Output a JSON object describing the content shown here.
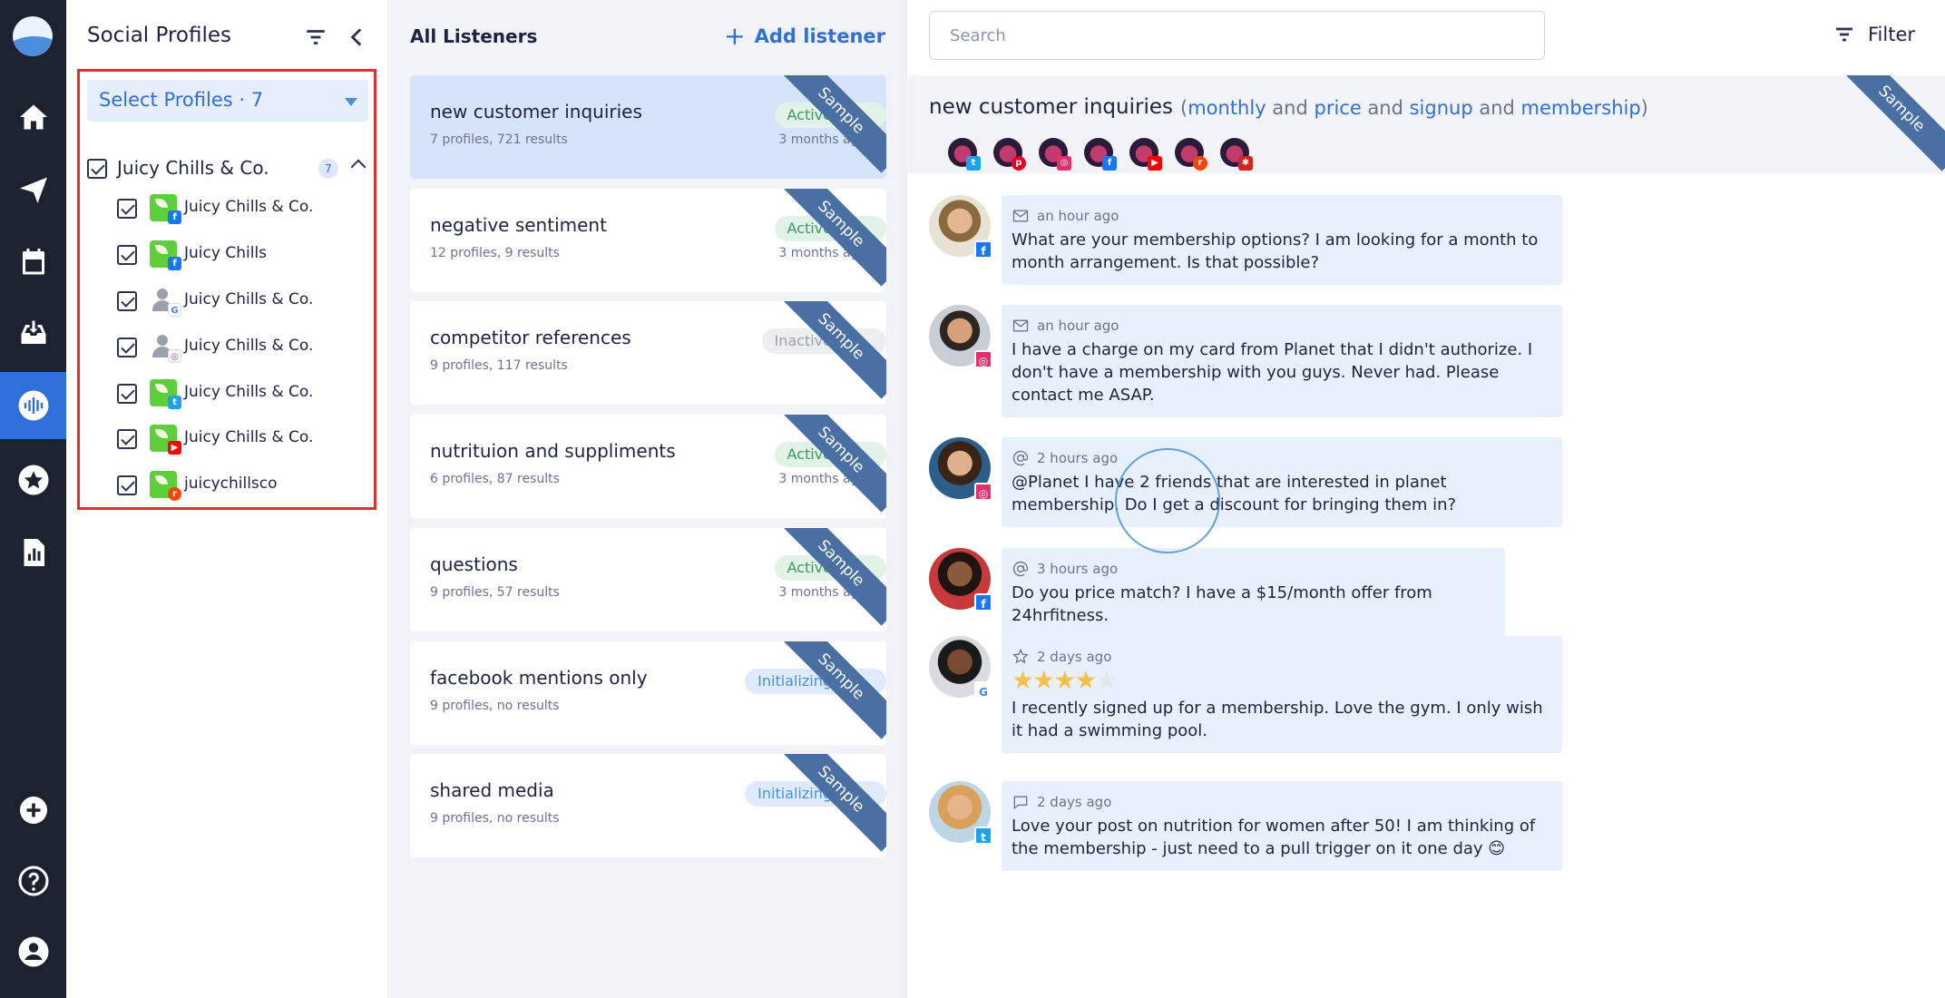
{
  "nav": [
    "home",
    "publish",
    "calendar",
    "inbox",
    "listening",
    "reviews",
    "reports",
    "add",
    "help",
    "account"
  ],
  "profiles_panel": {
    "title": "Social Profiles",
    "select_label": "Select Profiles · 7",
    "group": {
      "label": "Juicy Chills & Co.",
      "count": "7"
    },
    "items": [
      {
        "name": "Juicy Chills & Co.",
        "network": "facebook",
        "badge": "f"
      },
      {
        "name": "Juicy Chills",
        "network": "facebook",
        "badge": "f"
      },
      {
        "name": "Juicy Chills & Co.",
        "network": "google",
        "badge": "G"
      },
      {
        "name": "Juicy Chills & Co.",
        "network": "instagram",
        "badge": "◎"
      },
      {
        "name": "Juicy Chills & Co.",
        "network": "twitter",
        "badge": "t"
      },
      {
        "name": "Juicy Chills & Co.",
        "network": "youtube",
        "badge": "▶"
      },
      {
        "name": "juicychillsco",
        "network": "reddit",
        "badge": "r"
      }
    ]
  },
  "listeners": {
    "title": "All Listeners",
    "add_label": "Add listener",
    "ribbon": "Sample",
    "items": [
      {
        "title": "new customer inquiries",
        "sub": "7 profiles, 721 results",
        "status": "Active",
        "ago": "3 months ago"
      },
      {
        "title": "negative sentiment",
        "sub": "12 profiles, 9 results",
        "status": "Active",
        "ago": "3 months ago"
      },
      {
        "title": "competitor references",
        "sub": "9 profiles, 117 results",
        "status": "Inactive",
        "ago": ""
      },
      {
        "title": "nutrituion and suppliments",
        "sub": "6 profiles, 87 results",
        "status": "Active",
        "ago": "3 months ago"
      },
      {
        "title": "questions",
        "sub": "9 profiles, 57 results",
        "status": "Active",
        "ago": "3 months ago"
      },
      {
        "title": "facebook mentions only",
        "sub": "9 profiles, no results",
        "status": "Initializing",
        "ago": ""
      },
      {
        "title": "shared media",
        "sub": "9 profiles, no results",
        "status": "Initializing",
        "ago": ""
      }
    ]
  },
  "results": {
    "search_placeholder": "Search",
    "filter_label": "Filter",
    "title": "new customer inquiries",
    "keywords": {
      "open": "(",
      "w1": "monthly",
      "a1": " and ",
      "w2": "price",
      "a2": " and ",
      "w3": "signup",
      "a3": " and ",
      "w4": "membership",
      "close": ")"
    },
    "ribbon": "Sample",
    "channels": [
      "twitter",
      "pinterest",
      "instagram",
      "facebook",
      "youtube",
      "reddit",
      "yelp"
    ],
    "posts": [
      {
        "type": "message",
        "ago": "an hour ago",
        "network": "facebook",
        "text": "What are your membership options? I am looking for a month to month arrangement. Is that possible?"
      },
      {
        "type": "message",
        "ago": "an hour ago",
        "network": "instagram",
        "text": "I have a charge on my card from Planet that I didn't authorize. I don't have a membership with you guys. Never had. Please contact me ASAP."
      },
      {
        "type": "mention",
        "ago": "2 hours ago",
        "network": "instagram",
        "text": "@Planet I have 2 friends that are interested in planet membership. Do I get a discount for bringing them in?"
      },
      {
        "type": "mention",
        "ago": "3 hours ago",
        "network": "facebook",
        "text": "Do you price match? I have a $15/month offer from 24hrfitness."
      },
      {
        "type": "review",
        "ago": "2 days ago",
        "network": "google",
        "rating": 4,
        "text": "I recently signed up for a membership. Love the gym. I only wish it had a swimming pool."
      },
      {
        "type": "comment",
        "ago": "2 days ago",
        "network": "twitter",
        "text": "Love your post on nutrition for women after 50! I am thinking of the membership - just need to a pull trigger on it one day 😊"
      }
    ]
  },
  "colors": {
    "rail": "#1d2230",
    "accent": "#2f6fd9",
    "ribbon": "#4a6fa3",
    "selection_outline": "#e23030"
  }
}
